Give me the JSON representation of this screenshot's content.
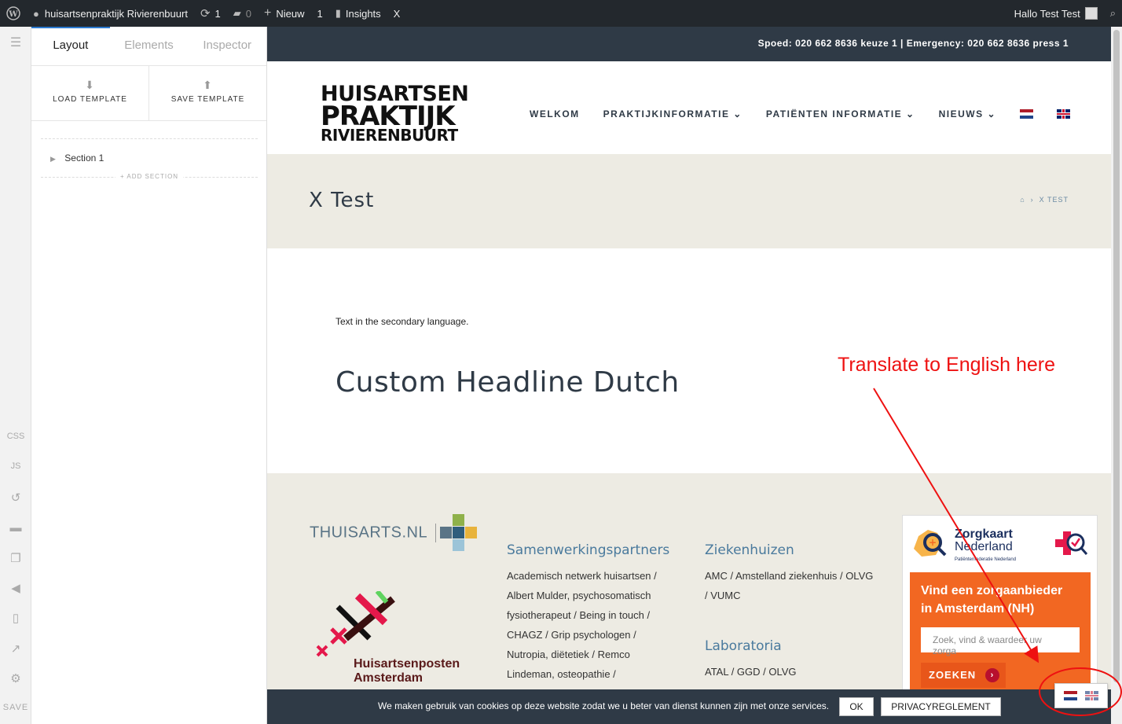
{
  "adminbar": {
    "site_name": "huisartsenpraktijk Rivierenbuurt",
    "updates_count": "1",
    "comments_count": "0",
    "new_label": "Nieuw",
    "new_count": "1",
    "insights_label": "Insights",
    "close_label": "X",
    "greeting": "Hallo Test Test"
  },
  "rail": {
    "css_label": "CSS",
    "js_label": "JS",
    "save_label": "SAVE"
  },
  "builder": {
    "tabs": [
      {
        "label": "Layout"
      },
      {
        "label": "Elements"
      },
      {
        "label": "Inspector"
      }
    ],
    "load_template": "LOAD TEMPLATE",
    "save_template": "SAVE TEMPLATE",
    "section_label": "Section 1",
    "add_section": "+ ADD SECTION"
  },
  "site": {
    "top_strip": "Spoed: 020 662 8636 keuze 1 | Emergency: 020 662 8636 press 1",
    "logo": {
      "line1": "HUISARTSEN",
      "line2": "PRAKTIJK",
      "line3": "RIVIERENBUURT"
    },
    "nav": [
      {
        "label": "WELKOM"
      },
      {
        "label": "PRAKTIJKINFORMATIE"
      },
      {
        "label": "PATIËNTEN INFORMATIE"
      },
      {
        "label": "NIEUWS"
      }
    ],
    "page_title": "X Test",
    "breadcrumb_current": "X TEST",
    "body_text": "Text in the secondary language.",
    "headline": "Custom Headline Dutch",
    "footer": {
      "thuisarts": "THUISARTS.NL",
      "partners_title": "Samenwerkingspartners",
      "partners_lines": [
        "Academisch netwerk huisartsen /",
        "Albert Mulder, psychosomatisch",
        "fysiotherapeut / Being in touch /",
        "CHAGZ / Grip psychologen /",
        "Nutropia, diëtetiek / Remco",
        "Lindeman, osteopathie /"
      ],
      "hospitals_title": "Ziekenhuizen",
      "hospitals_lines": [
        "AMC / Amstelland ziekenhuis / OLVG",
        "/ VUMC"
      ],
      "labs_title": "Laboratoria",
      "labs_lines": [
        "ATAL / GGD / OLVG"
      ],
      "hap_line1": "Huisartsenposten",
      "hap_line2": "Amsterdam"
    },
    "zorgkaart": {
      "title1": "Zorgkaart",
      "title2": "Nederland",
      "subtitle": "Patiëntenfederatie Nederland",
      "heading1": "Vind een zorgaanbieder",
      "heading2": "in Amsterdam (NH)",
      "placeholder": "Zoek, vind & waardeer uw zorga",
      "button": "ZOEKEN"
    },
    "cookie": {
      "message": "We maken gebruik van cookies op deze website zodat we u beter van dienst kunnen zijn met onze services.",
      "ok": "OK",
      "privacy": "PRIVACYREGLEMENT"
    }
  },
  "annotation": "Translate to English here",
  "colors": {
    "annotation": "#ee1111",
    "accent": "#2c7bd1",
    "orange": "#f26722"
  }
}
